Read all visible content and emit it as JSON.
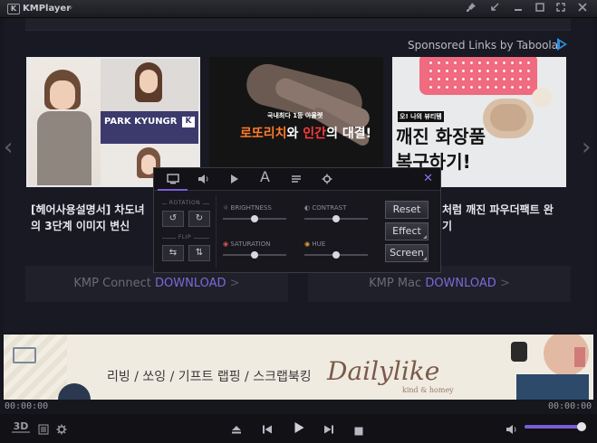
{
  "app": {
    "title": "KMPlayer"
  },
  "sponsored": {
    "label": "Sponsored Links by Taboola"
  },
  "cards": [
    {
      "caption_line1": "[헤어사용설명서] 차도녀",
      "caption_line2": "의 3단계 이미지 변신",
      "overlay_title": "PARK KYUNGR",
      "overlay_tag": "K"
    },
    {
      "overlay_line1": "국내최다 1등 아울렛",
      "overlay_line2a": "로또리치",
      "overlay_line2b": "와 ",
      "overlay_line2c": "인간",
      "overlay_line2d": "의 대결!"
    },
    {
      "caption_line1": "처럼 깨진 파우더팩트 완",
      "caption_line2": "기",
      "overlay_small": "오! 나의 뷰티템",
      "overlay_line1": "깨진 화장품",
      "overlay_line2": "복구하기!"
    }
  ],
  "downloads": [
    {
      "prefix": "KMP Connect ",
      "highlight": "DOWNLOAD",
      "arrow": ">"
    },
    {
      "prefix": "KMP Mac ",
      "highlight": "DOWNLOAD",
      "arrow": ">"
    }
  ],
  "banner": {
    "text": "리빙 / 쏘잉 / 기프트 랩핑 / 스크랩북킹",
    "brand": "Dailylike",
    "tagline": "kind & homey"
  },
  "player": {
    "time_elapsed": "00:00:00",
    "time_total": "00:00:00",
    "three_d_label": "3D",
    "volume_level": 0.92
  },
  "panel": {
    "close": "✕",
    "rotation_label": "ROTATION",
    "flip_label": "FLIP",
    "sliders": [
      {
        "label": "BRIGHTNESS",
        "level": 0.5
      },
      {
        "label": "CONTRAST",
        "level": 0.5
      },
      {
        "label": "SATURATION",
        "level": 0.5
      },
      {
        "label": "HUE",
        "level": 0.5
      }
    ],
    "buttons": {
      "reset": "Reset",
      "effect": "Effect",
      "screen": "Screen"
    }
  },
  "colors": {
    "accent": "#7a5cd6",
    "taboola": "#2a8fe0",
    "window_bg": "#191923"
  }
}
